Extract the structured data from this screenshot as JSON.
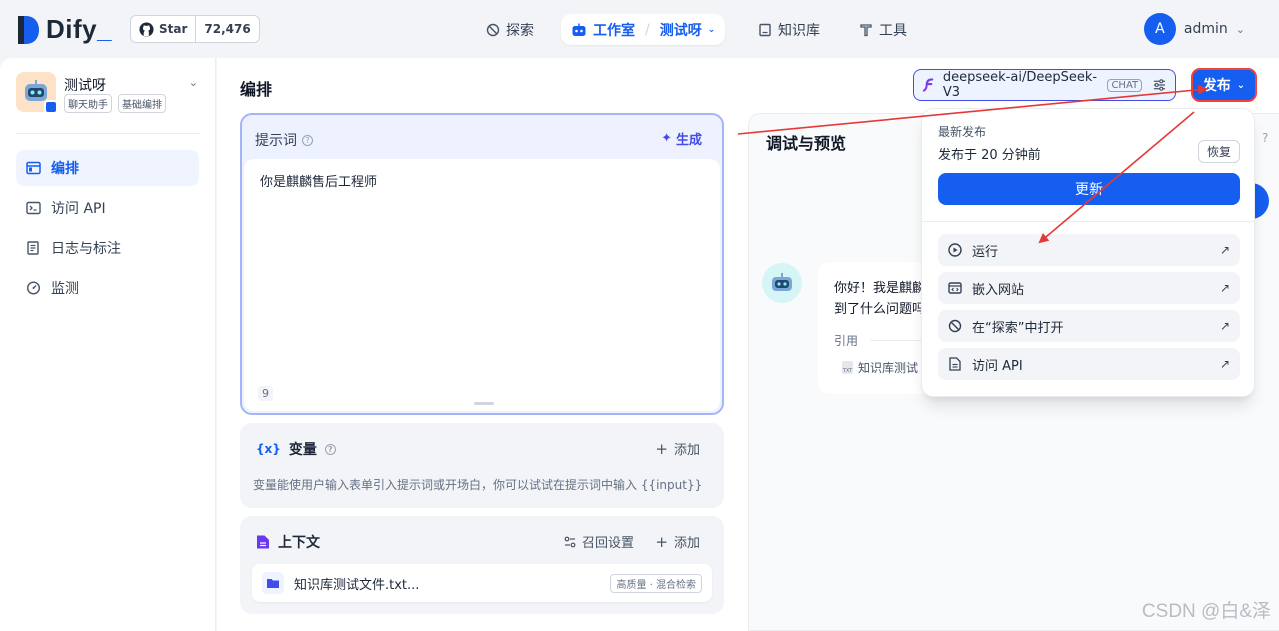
{
  "header": {
    "brand": "Dify",
    "github": {
      "star_label": "Star",
      "count": "72,476"
    },
    "nav": [
      {
        "label": "探索"
      },
      {
        "label": "工作室",
        "sub": "测试呀"
      },
      {
        "label": "知识库"
      },
      {
        "label": "工具"
      }
    ],
    "user": {
      "initial": "A",
      "name": "admin"
    }
  },
  "sidebar": {
    "app_name": "测试呀",
    "tags": [
      "聊天助手",
      "基础编排"
    ],
    "items": [
      {
        "label": "编排",
        "active": true
      },
      {
        "label": "访问 API"
      },
      {
        "label": "日志与标注"
      },
      {
        "label": "监测"
      }
    ]
  },
  "main": {
    "title": "编排",
    "model": {
      "name": "deepseek-ai/DeepSeek-V3",
      "mode": "CHAT"
    },
    "publish_label": "发布",
    "prompt": {
      "title": "提示词",
      "generate_label": "生成",
      "text": "你是麒麟售后工程师",
      "char_count": "9"
    },
    "variables": {
      "title": "变量",
      "add_label": "添加",
      "description": "变量能使用户输入表单引入提示词或开场白，你可以试试在提示词中输入 {{input}}"
    },
    "context": {
      "title": "上下文",
      "recall_label": "召回设置",
      "add_label": "添加",
      "dataset_name": "知识库测试文件.txt...",
      "dataset_badge": "高质量 · 混合检索"
    }
  },
  "preview": {
    "title": "调试与预览",
    "message_line1": "你好！我是麒麟",
    "message_line2": "到了什么问题吗",
    "cite_label": "引用",
    "cite_file": "知识库测试"
  },
  "publish_menu": {
    "latest_label": "最新发布",
    "published_time": "发布于 20 分钟前",
    "restore_label": "恢复",
    "update_label": "更新",
    "items": [
      {
        "label": "运行"
      },
      {
        "label": "嵌入网站"
      },
      {
        "label": "在“探索”中打开"
      },
      {
        "label": "访问 API"
      }
    ]
  },
  "watermark": "CSDN @白&泽",
  "colors": {
    "primary": "#155eef",
    "annotation_arrow": "#e53935"
  }
}
